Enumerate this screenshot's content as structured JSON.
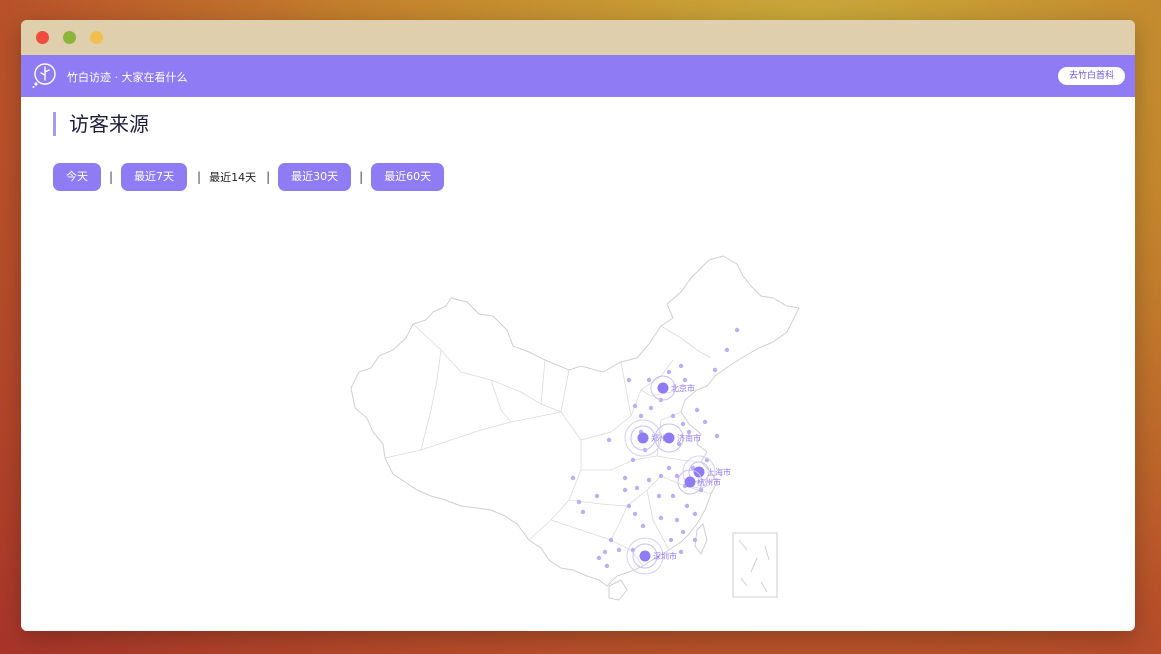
{
  "window": {
    "controls": [
      "close",
      "minimize",
      "maximize"
    ]
  },
  "navbar": {
    "logo_icon": "bamboo-logo-icon",
    "title": "竹白访迹 · 大家在看什么",
    "link_button": "去竹白首科"
  },
  "section": {
    "title": "访客来源"
  },
  "filters": {
    "today": "今天",
    "last7": "最近7天",
    "last14": "最近14天",
    "last30": "最近30天",
    "last60": "最近60天",
    "separator": "|"
  },
  "map": {
    "accent_color": "#8f7cf5",
    "cities": [
      {
        "name": "北京市"
      },
      {
        "name": "郑州市"
      },
      {
        "name": "济南市"
      },
      {
        "name": "上海市"
      },
      {
        "name": "杭州市"
      },
      {
        "name": "深圳市"
      }
    ]
  },
  "colors": {
    "titlebar": "#e0cfad",
    "navbar": "#8f7cf5",
    "accent": "#8f7cf5"
  }
}
